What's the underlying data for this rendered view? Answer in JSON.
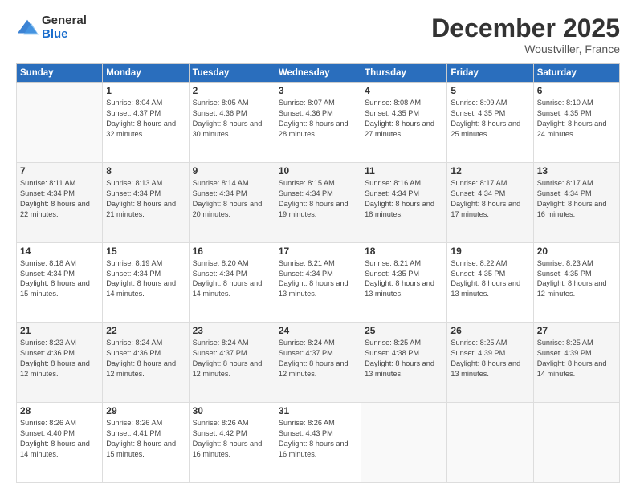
{
  "logo": {
    "general": "General",
    "blue": "Blue"
  },
  "header": {
    "month": "December 2025",
    "location": "Woustviller, France"
  },
  "days_of_week": [
    "Sunday",
    "Monday",
    "Tuesday",
    "Wednesday",
    "Thursday",
    "Friday",
    "Saturday"
  ],
  "weeks": [
    [
      {
        "day": "",
        "sunrise": "",
        "sunset": "",
        "daylight": ""
      },
      {
        "day": "1",
        "sunrise": "Sunrise: 8:04 AM",
        "sunset": "Sunset: 4:37 PM",
        "daylight": "Daylight: 8 hours and 32 minutes."
      },
      {
        "day": "2",
        "sunrise": "Sunrise: 8:05 AM",
        "sunset": "Sunset: 4:36 PM",
        "daylight": "Daylight: 8 hours and 30 minutes."
      },
      {
        "day": "3",
        "sunrise": "Sunrise: 8:07 AM",
        "sunset": "Sunset: 4:36 PM",
        "daylight": "Daylight: 8 hours and 28 minutes."
      },
      {
        "day": "4",
        "sunrise": "Sunrise: 8:08 AM",
        "sunset": "Sunset: 4:35 PM",
        "daylight": "Daylight: 8 hours and 27 minutes."
      },
      {
        "day": "5",
        "sunrise": "Sunrise: 8:09 AM",
        "sunset": "Sunset: 4:35 PM",
        "daylight": "Daylight: 8 hours and 25 minutes."
      },
      {
        "day": "6",
        "sunrise": "Sunrise: 8:10 AM",
        "sunset": "Sunset: 4:35 PM",
        "daylight": "Daylight: 8 hours and 24 minutes."
      }
    ],
    [
      {
        "day": "7",
        "sunrise": "Sunrise: 8:11 AM",
        "sunset": "Sunset: 4:34 PM",
        "daylight": "Daylight: 8 hours and 22 minutes."
      },
      {
        "day": "8",
        "sunrise": "Sunrise: 8:13 AM",
        "sunset": "Sunset: 4:34 PM",
        "daylight": "Daylight: 8 hours and 21 minutes."
      },
      {
        "day": "9",
        "sunrise": "Sunrise: 8:14 AM",
        "sunset": "Sunset: 4:34 PM",
        "daylight": "Daylight: 8 hours and 20 minutes."
      },
      {
        "day": "10",
        "sunrise": "Sunrise: 8:15 AM",
        "sunset": "Sunset: 4:34 PM",
        "daylight": "Daylight: 8 hours and 19 minutes."
      },
      {
        "day": "11",
        "sunrise": "Sunrise: 8:16 AM",
        "sunset": "Sunset: 4:34 PM",
        "daylight": "Daylight: 8 hours and 18 minutes."
      },
      {
        "day": "12",
        "sunrise": "Sunrise: 8:17 AM",
        "sunset": "Sunset: 4:34 PM",
        "daylight": "Daylight: 8 hours and 17 minutes."
      },
      {
        "day": "13",
        "sunrise": "Sunrise: 8:17 AM",
        "sunset": "Sunset: 4:34 PM",
        "daylight": "Daylight: 8 hours and 16 minutes."
      }
    ],
    [
      {
        "day": "14",
        "sunrise": "Sunrise: 8:18 AM",
        "sunset": "Sunset: 4:34 PM",
        "daylight": "Daylight: 8 hours and 15 minutes."
      },
      {
        "day": "15",
        "sunrise": "Sunrise: 8:19 AM",
        "sunset": "Sunset: 4:34 PM",
        "daylight": "Daylight: 8 hours and 14 minutes."
      },
      {
        "day": "16",
        "sunrise": "Sunrise: 8:20 AM",
        "sunset": "Sunset: 4:34 PM",
        "daylight": "Daylight: 8 hours and 14 minutes."
      },
      {
        "day": "17",
        "sunrise": "Sunrise: 8:21 AM",
        "sunset": "Sunset: 4:34 PM",
        "daylight": "Daylight: 8 hours and 13 minutes."
      },
      {
        "day": "18",
        "sunrise": "Sunrise: 8:21 AM",
        "sunset": "Sunset: 4:35 PM",
        "daylight": "Daylight: 8 hours and 13 minutes."
      },
      {
        "day": "19",
        "sunrise": "Sunrise: 8:22 AM",
        "sunset": "Sunset: 4:35 PM",
        "daylight": "Daylight: 8 hours and 13 minutes."
      },
      {
        "day": "20",
        "sunrise": "Sunrise: 8:23 AM",
        "sunset": "Sunset: 4:35 PM",
        "daylight": "Daylight: 8 hours and 12 minutes."
      }
    ],
    [
      {
        "day": "21",
        "sunrise": "Sunrise: 8:23 AM",
        "sunset": "Sunset: 4:36 PM",
        "daylight": "Daylight: 8 hours and 12 minutes."
      },
      {
        "day": "22",
        "sunrise": "Sunrise: 8:24 AM",
        "sunset": "Sunset: 4:36 PM",
        "daylight": "Daylight: 8 hours and 12 minutes."
      },
      {
        "day": "23",
        "sunrise": "Sunrise: 8:24 AM",
        "sunset": "Sunset: 4:37 PM",
        "daylight": "Daylight: 8 hours and 12 minutes."
      },
      {
        "day": "24",
        "sunrise": "Sunrise: 8:24 AM",
        "sunset": "Sunset: 4:37 PM",
        "daylight": "Daylight: 8 hours and 12 minutes."
      },
      {
        "day": "25",
        "sunrise": "Sunrise: 8:25 AM",
        "sunset": "Sunset: 4:38 PM",
        "daylight": "Daylight: 8 hours and 13 minutes."
      },
      {
        "day": "26",
        "sunrise": "Sunrise: 8:25 AM",
        "sunset": "Sunset: 4:39 PM",
        "daylight": "Daylight: 8 hours and 13 minutes."
      },
      {
        "day": "27",
        "sunrise": "Sunrise: 8:25 AM",
        "sunset": "Sunset: 4:39 PM",
        "daylight": "Daylight: 8 hours and 14 minutes."
      }
    ],
    [
      {
        "day": "28",
        "sunrise": "Sunrise: 8:26 AM",
        "sunset": "Sunset: 4:40 PM",
        "daylight": "Daylight: 8 hours and 14 minutes."
      },
      {
        "day": "29",
        "sunrise": "Sunrise: 8:26 AM",
        "sunset": "Sunset: 4:41 PM",
        "daylight": "Daylight: 8 hours and 15 minutes."
      },
      {
        "day": "30",
        "sunrise": "Sunrise: 8:26 AM",
        "sunset": "Sunset: 4:42 PM",
        "daylight": "Daylight: 8 hours and 16 minutes."
      },
      {
        "day": "31",
        "sunrise": "Sunrise: 8:26 AM",
        "sunset": "Sunset: 4:43 PM",
        "daylight": "Daylight: 8 hours and 16 minutes."
      },
      {
        "day": "",
        "sunrise": "",
        "sunset": "",
        "daylight": ""
      },
      {
        "day": "",
        "sunrise": "",
        "sunset": "",
        "daylight": ""
      },
      {
        "day": "",
        "sunrise": "",
        "sunset": "",
        "daylight": ""
      }
    ]
  ]
}
